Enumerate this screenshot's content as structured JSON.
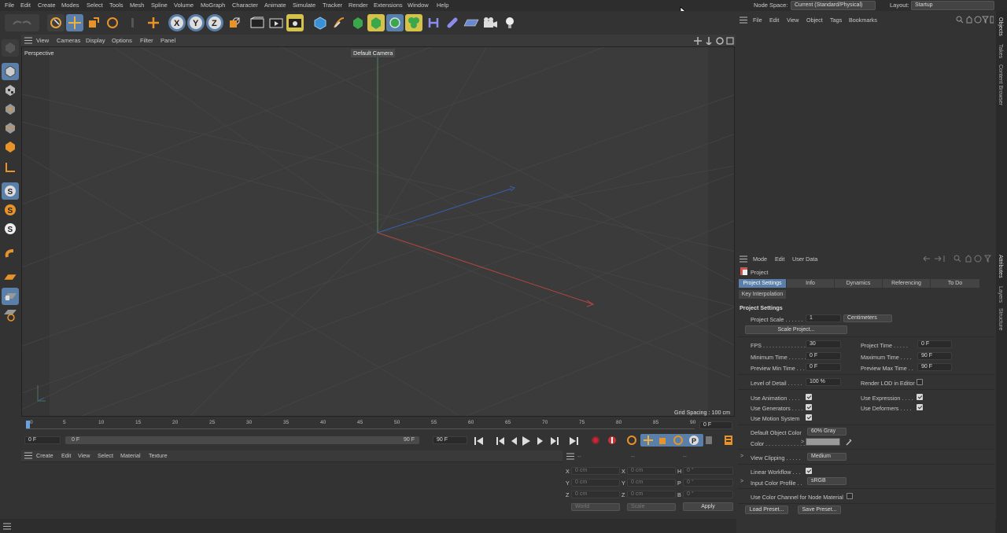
{
  "menubar": {
    "items": [
      "File",
      "Edit",
      "Create",
      "Modes",
      "Select",
      "Tools",
      "Mesh",
      "Spline",
      "Volume",
      "MoGraph",
      "Character",
      "Animate",
      "Simulate",
      "Tracker",
      "Render",
      "Extensions",
      "Window",
      "Help"
    ],
    "node_space_label": "Node Space:",
    "node_space_value": "Current (Standard/Physical)",
    "layout_label": "Layout:",
    "layout_value": "Startup"
  },
  "viewport": {
    "menu": [
      "View",
      "Cameras",
      "Display",
      "Options",
      "Filter",
      "Panel"
    ],
    "view_name": "Perspective",
    "camera": "Default Camera",
    "grid_spacing": "Grid Spacing : 100 cm"
  },
  "timeline": {
    "ticks": [
      "0",
      "5",
      "10",
      "15",
      "20",
      "25",
      "30",
      "35",
      "40",
      "45",
      "50",
      "55",
      "60",
      "65",
      "70",
      "75",
      "80",
      "85",
      "90"
    ],
    "current_frame": "0 F",
    "start": "0 F",
    "start2": "0 F",
    "end": "90 F",
    "end2": "90 F"
  },
  "material": {
    "menu": [
      "Create",
      "Edit",
      "View",
      "Select",
      "Material",
      "Texture"
    ]
  },
  "coords": {
    "header1": "--",
    "header2": "--",
    "header3": "--",
    "x_pos": "0 cm",
    "y_pos": "0 cm",
    "z_pos": "0 cm",
    "x_size": "0 cm",
    "y_size": "0 cm",
    "z_size": "0 cm",
    "h": "0 °",
    "p": "0 °",
    "b": "0 °",
    "mode1": "World",
    "mode2": "Scale",
    "apply": "Apply"
  },
  "objects": {
    "menu": [
      "File",
      "Edit",
      "View",
      "Object",
      "Tags",
      "Bookmarks"
    ]
  },
  "attributes": {
    "menu": [
      "Mode",
      "Edit",
      "User Data"
    ],
    "object_name": "Project",
    "tabs": [
      "Project Settings",
      "Info",
      "Dynamics",
      "Referencing",
      "To Do"
    ],
    "tab2": "Key Interpolation",
    "section_title": "Project Settings",
    "project_scale_label": "Project Scale . . . . . .",
    "project_scale": "1",
    "scale_unit": "Centimeters",
    "scale_project_btn": "Scale Project...",
    "fps_label": "FPS . . . . . . . . . . . . . .",
    "fps": "30",
    "project_time_label": "Project Time . . . . .",
    "project_time": "0 F",
    "min_time_label": "Minimum Time . . . . . .",
    "min_time": "0 F",
    "max_time_label": "Maximum Time . . . .",
    "max_time": "90 F",
    "prev_min_label": "Preview Min Time . . .",
    "prev_min": "0 F",
    "prev_max_label": "Preview Max Time . .",
    "prev_max": "90 F",
    "lod_label": "Level of Detail . . . . .",
    "lod": "100 %",
    "render_lod_label": "Render LOD in Editor",
    "use_animation": "Use Animation . . . .",
    "use_expression": "Use Expression . . . .",
    "use_generators": "Use Generators . . . .",
    "use_deformers": "Use Deformers . . . .",
    "use_motion": "Use Motion System",
    "default_color_label": "Default Object Color",
    "default_color": "60% Gray",
    "color_label": "Color . . . . . . . . . . . . .",
    "view_clipping_label": "View Clipping . . . . .",
    "view_clipping": "Medium",
    "linear_workflow_label": "Linear Workflow . . .",
    "input_profile_label": "Input Color Profile . .",
    "input_profile": "sRGB",
    "color_channel_label": "Use Color Channel for Node Material",
    "load_preset": "Load Preset...",
    "save_preset": "Save Preset..."
  },
  "rightbar": {
    "top": [
      "Objects",
      "Takes",
      "Content Browser"
    ],
    "bottom": [
      "Attributes",
      "Layers",
      "Structure"
    ]
  }
}
